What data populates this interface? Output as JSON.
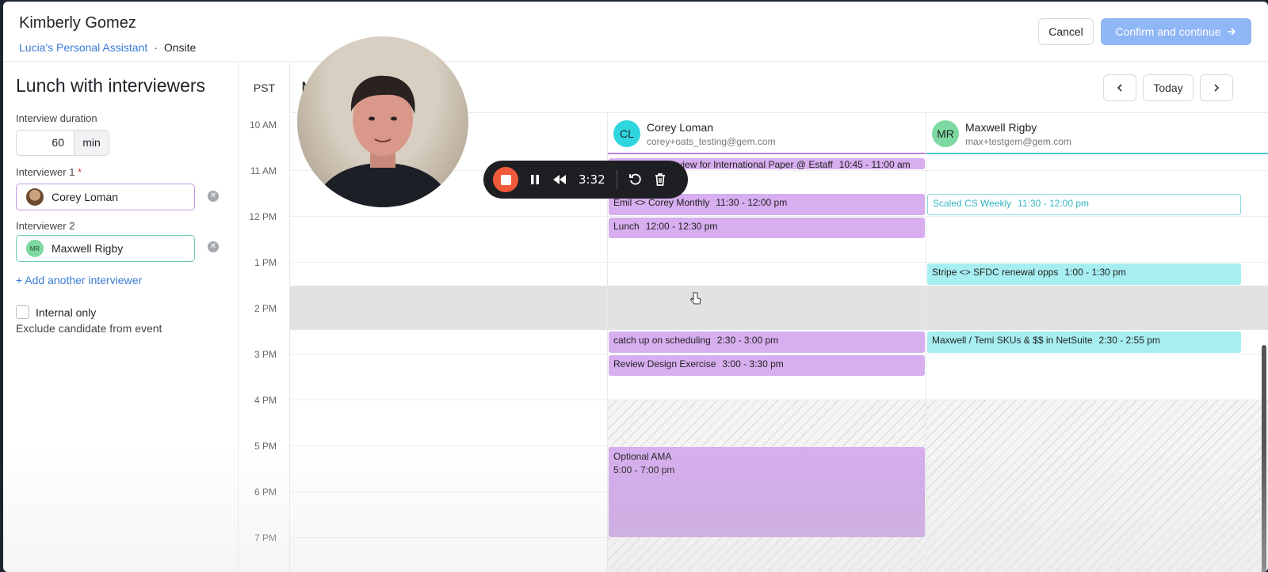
{
  "header": {
    "candidate_name": "Kimberly Gomez",
    "job_title": "Lucia's Personal Assistant",
    "separator": "·",
    "stage": "Onsite",
    "cancel_label": "Cancel",
    "confirm_label": "Confirm and continue",
    "confirm_icon": "arrow-right-icon"
  },
  "form": {
    "event_title": "Lunch with interviewers",
    "duration_label": "Interview duration",
    "duration_value": "60",
    "duration_unit": "min",
    "interviewer1_label": "Interviewer 1",
    "required_mark": "*",
    "interviewer1_name": "Corey Loman",
    "interviewer2_label": "Interviewer 2",
    "interviewer2_initials": "MR",
    "interviewer2_name": "Maxwell Rigby",
    "add_interviewer": "+ Add another interviewer",
    "internal_only_label": "Internal only",
    "internal_only_checked": false,
    "internal_only_help": "Exclude candidate from event"
  },
  "calendar": {
    "timezone": "PST",
    "title_visible": "M",
    "today_label": "Today",
    "hours": [
      "10 AM",
      "11 AM",
      "12 PM",
      "1 PM",
      "2 PM",
      "3 PM",
      "4 PM",
      "5 PM",
      "6 PM",
      "7 PM"
    ],
    "col0_partial": ")",
    "columns": [
      {
        "initials": "CL",
        "name": "Corey Loman",
        "email": "corey+oats_testing@gem.com",
        "color": "#2fd6e0"
      },
      {
        "initials": "MR",
        "name": "Maxwell Rigby",
        "email": "max+testgem@gem.com",
        "color": "#7dd9a1"
      }
    ],
    "events_corey": [
      {
        "title": "Candidate interview for International Paper @ Estaff",
        "time": "10:45 - 11:00 am"
      },
      {
        "title": "Emil <> Corey Monthly",
        "time": "11:30 - 12:00 pm"
      },
      {
        "title": "Lunch",
        "time": "12:00 - 12:30 pm"
      },
      {
        "title": "catch up on scheduling",
        "time": "2:30 - 3:00 pm"
      },
      {
        "title": "Review Design Exercise",
        "time": "3:00 - 3:30 pm"
      },
      {
        "title": "Optional AMA",
        "time": "5:00 - 7:00 pm"
      }
    ],
    "events_maxwell": [
      {
        "title": "Scaled CS Weekly",
        "time": "11:30 - 12:00 pm"
      },
      {
        "title": "Stripe <> SFDC renewal opps",
        "time": "1:00 - 1:30 pm"
      },
      {
        "title": "Maxwell / Temi SKUs & $$ in NetSuite",
        "time": "2:30 - 2:55 pm"
      }
    ],
    "colors": {
      "purple": "#d7aeef",
      "cyan": "#a7eef0",
      "link": "#3a7bd5",
      "confirm": "#8fb6f5"
    }
  },
  "recorder": {
    "elapsed": "3:32"
  }
}
